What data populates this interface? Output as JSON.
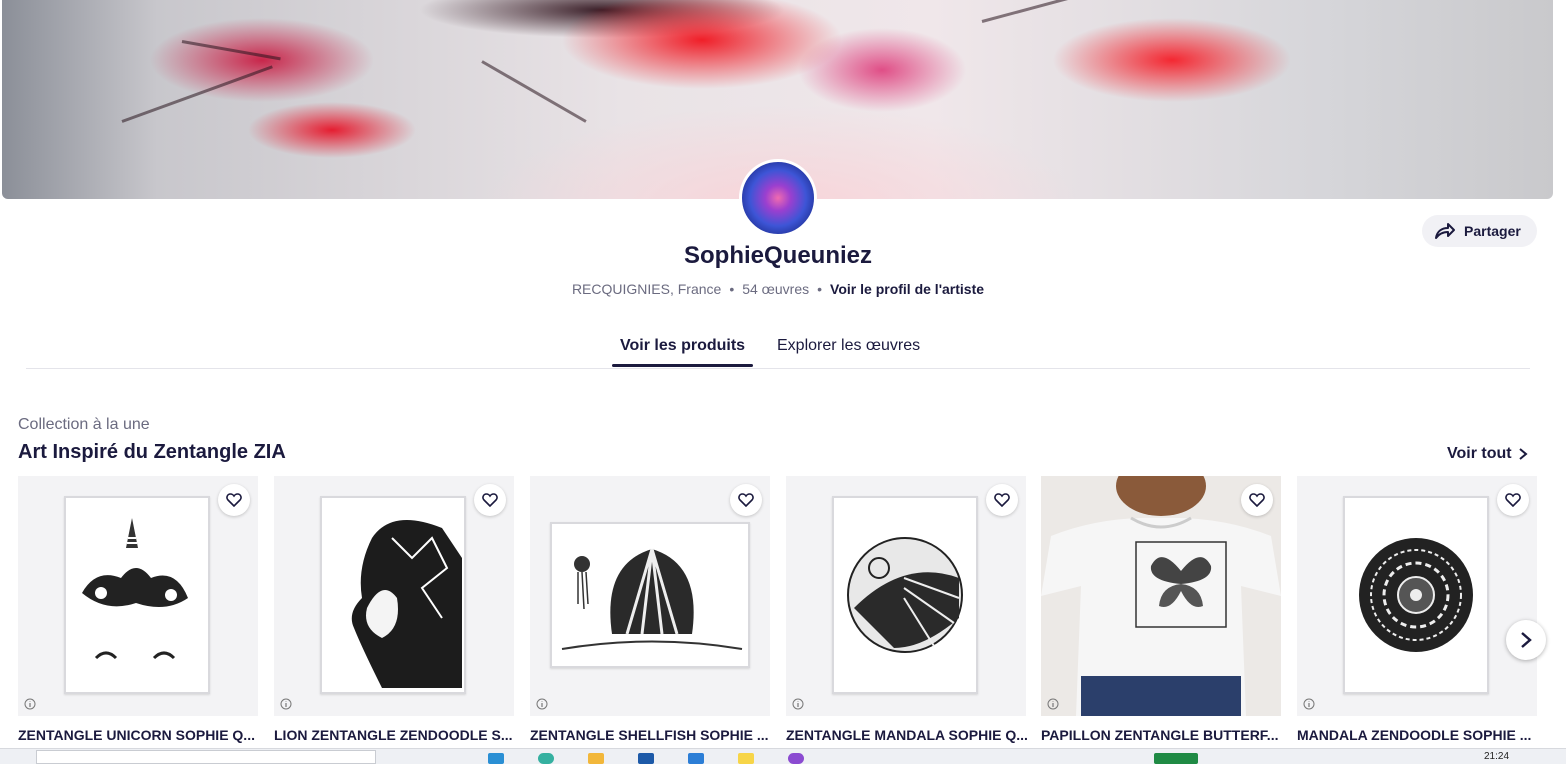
{
  "profile": {
    "name": "SophieQueuniez",
    "location": "RECQUIGNIES, France",
    "works_count": "54 œuvres",
    "profile_link": "Voir le profil de l'artiste",
    "share_label": "Partager"
  },
  "tabs": [
    {
      "label": "Voir les produits",
      "active": true
    },
    {
      "label": "Explorer les œuvres",
      "active": false
    }
  ],
  "collection": {
    "label": "Collection à la une",
    "title": "Art Inspiré du Zentangle ZIA",
    "see_all": "Voir tout"
  },
  "products": [
    {
      "title": "ZENTANGLE UNICORN SOPHIE Q..."
    },
    {
      "title": "LION ZENTANGLE ZENDOODLE S..."
    },
    {
      "title": "ZENTANGLE SHELLFISH SOPHIE ..."
    },
    {
      "title": "ZENTANGLE MANDALA SOPHIE Q..."
    },
    {
      "title": "PAPILLON ZENTANGLE BUTTERF..."
    },
    {
      "title": "MANDALA ZENDOODLE SOPHIE ..."
    }
  ],
  "taskbar": {
    "clock": "21:24"
  },
  "colors": {
    "brand_dark": "#1b1a3e",
    "muted": "#6b6b80"
  }
}
